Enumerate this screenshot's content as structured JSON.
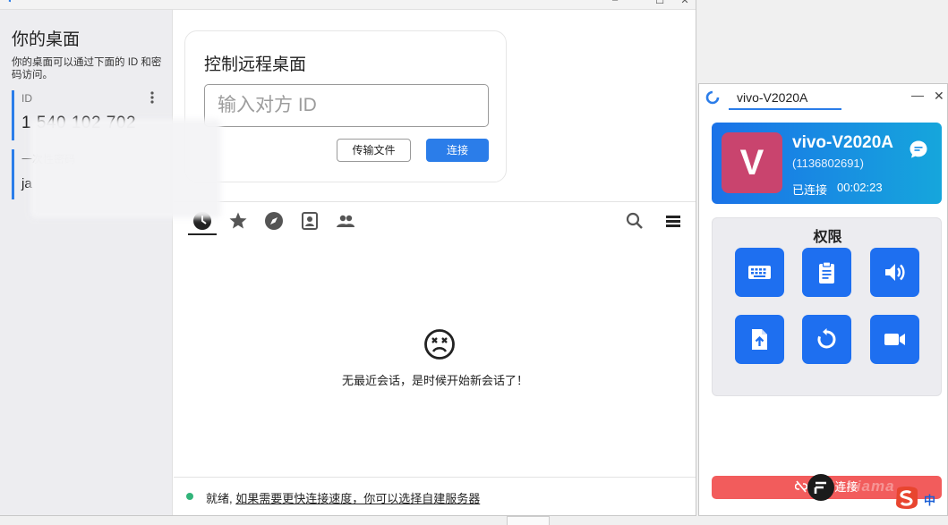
{
  "main": {
    "left": {
      "title": "你的桌面",
      "description": "你的桌面可以通过下面的 ID 和密码访问。",
      "id_label": "ID",
      "id_value": "1 540 102 702",
      "password_label": "一次性密码",
      "password_value": "ja"
    },
    "control": {
      "title": "控制远程桌面",
      "input_placeholder": "输入对方 ID",
      "transfer_label": "传输文件",
      "connect_label": "连接"
    },
    "tabs": [
      {
        "name": "recent-sessions"
      },
      {
        "name": "favorites"
      },
      {
        "name": "discovered"
      },
      {
        "name": "address-book"
      },
      {
        "name": "group"
      }
    ],
    "empty_message": "无最近会话，是时候开始新会话了！",
    "status": {
      "prefix": "就绪, ",
      "link": "如果需要更快连接速度，你可以选择自建服务器"
    }
  },
  "cm": {
    "tab_label": "vivo-V2020A",
    "peer": {
      "avatar_letter": "V",
      "name": "vivo-V2020A",
      "id": "(1136802691)",
      "status": "已连接",
      "duration": "00:02:23"
    },
    "permissions": {
      "title": "权限",
      "items": [
        "keyboard",
        "clipboard",
        "audio",
        "file-transfer",
        "restart",
        "recording"
      ]
    },
    "disconnect_label": "断开连接"
  },
  "overlay": {
    "watermark": "chiama",
    "ime_lang": "中"
  },
  "colors": {
    "accent": "#2b7de9",
    "perm_button": "#1e6ff0",
    "avatar": "#c9446e",
    "disconnect": "#f25c5c",
    "status_ok": "#32b47a"
  }
}
